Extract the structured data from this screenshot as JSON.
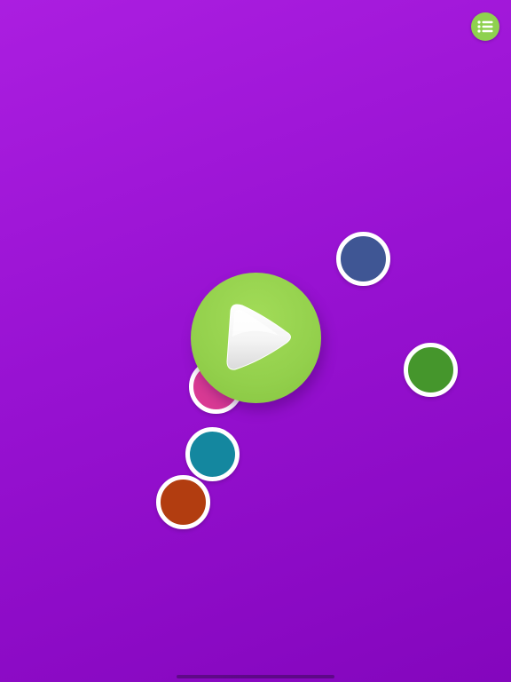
{
  "app": {
    "background_top": "#ab1ee0",
    "background_bottom": "#8406bd"
  },
  "menu_button": {
    "icon": "list-icon",
    "color": "#8fd14f"
  },
  "play_button": {
    "icon": "play-icon",
    "color": "#93d04c"
  },
  "color_dots": [
    {
      "name": "dot-navy",
      "color": "#3f5694"
    },
    {
      "name": "dot-green",
      "color": "#45962c"
    },
    {
      "name": "dot-pink",
      "color": "#d93a94"
    },
    {
      "name": "dot-teal",
      "color": "#14879f"
    },
    {
      "name": "dot-orange",
      "color": "#b23d10"
    }
  ]
}
